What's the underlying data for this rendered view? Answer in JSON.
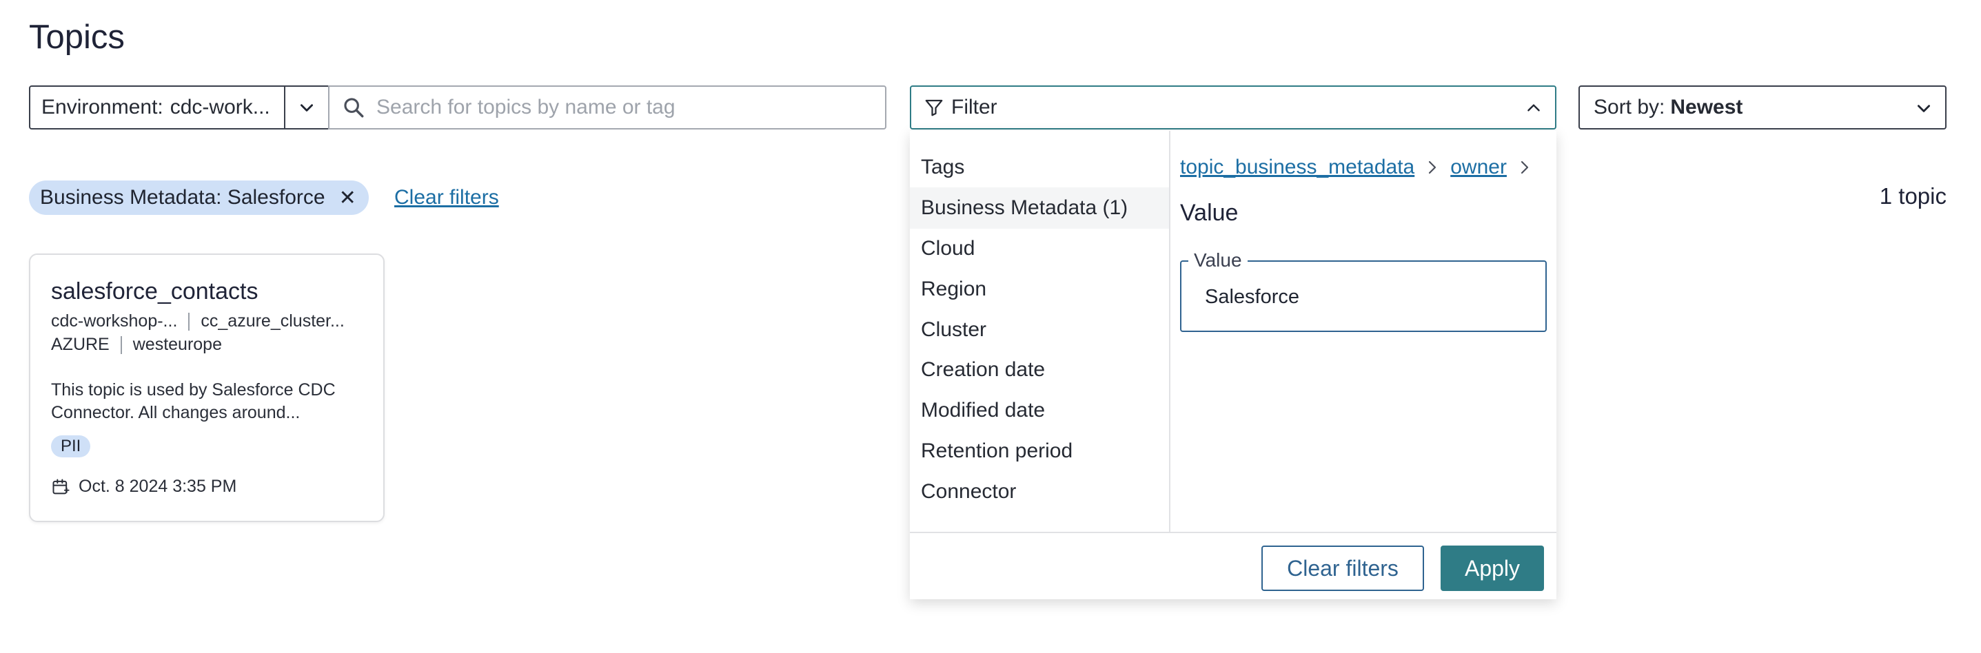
{
  "page": {
    "title": "Topics"
  },
  "toolbar": {
    "environment_label": "Environment:",
    "environment_value": "cdc-work...",
    "search_placeholder": "Search for topics by name or tag",
    "filter_label": "Filter",
    "sort_label": "Sort by:",
    "sort_value": "Newest"
  },
  "active_filters": {
    "chips": [
      {
        "label": "Business Metadata: Salesforce",
        "remove_icon": "close-icon"
      }
    ],
    "clear_label": "Clear filters",
    "result_count": "1 topic"
  },
  "topics": [
    {
      "name": "salesforce_contacts",
      "environment": "cdc-workshop-...",
      "cluster": "cc_azure_cluster...",
      "cloud": "AZURE",
      "region": "westeurope",
      "description": "This topic is used by Salesforce CDC Connector. All changes around...",
      "tags": [
        "PII"
      ],
      "created": "Oct. 8 2024 3:35 PM"
    }
  ],
  "filter_panel": {
    "categories": [
      "Tags",
      "Business Metadata (1)",
      "Cloud",
      "Region",
      "Cluster",
      "Creation date",
      "Modified date",
      "Retention period",
      "Connector"
    ],
    "active_category": "Business Metadata (1)",
    "breadcrumb": [
      "topic_business_metadata",
      "owner"
    ],
    "value_title": "Value",
    "value_field_label": "Value",
    "value_field_value": "Salesforce",
    "clear_button": "Clear filters",
    "apply_button": "Apply"
  },
  "colors": {
    "accent": "#2f7c86",
    "link": "#1c6ea4",
    "chip_bg": "#cfe0f7"
  }
}
